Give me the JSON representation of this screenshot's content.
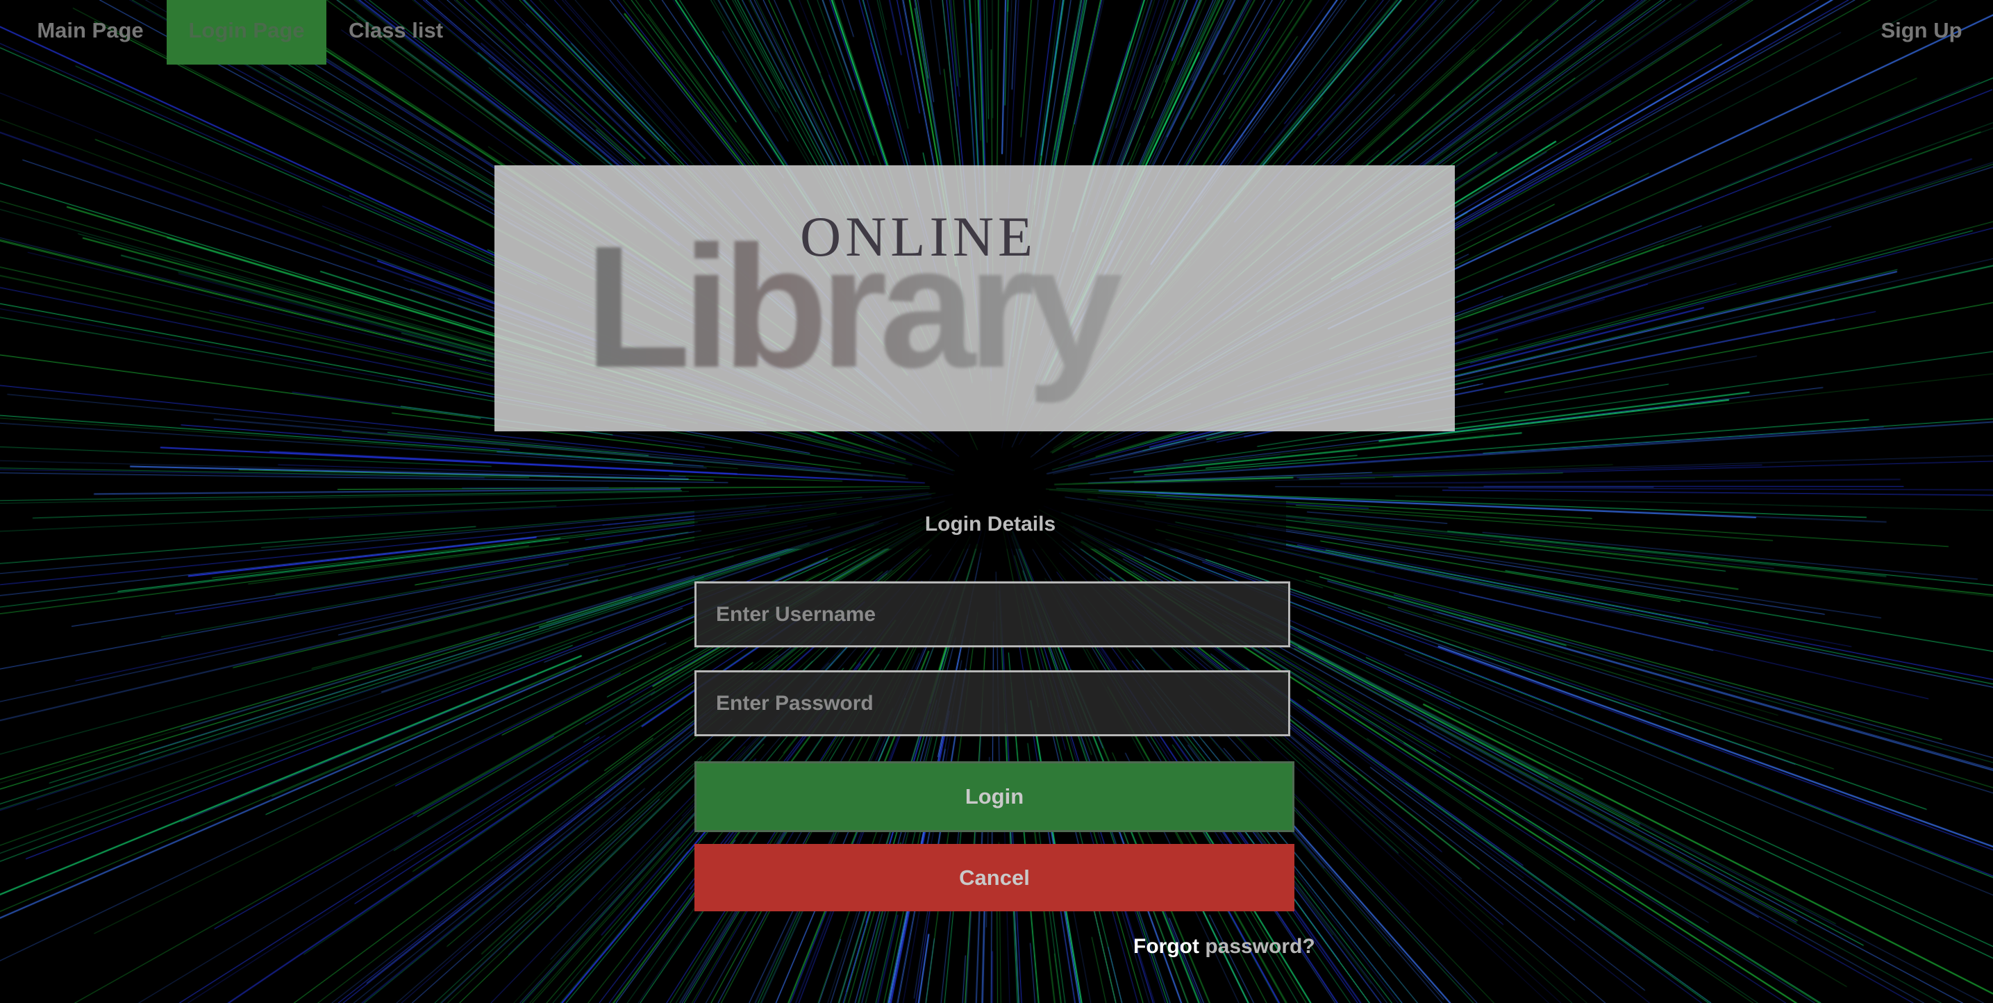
{
  "nav": {
    "items": [
      {
        "label": "Main Page"
      },
      {
        "label": "Login Page",
        "active": true
      },
      {
        "label": "Class list"
      }
    ],
    "signup_label": "Sign Up",
    "active_color": "#2f7a33"
  },
  "logo": {
    "top_text": "ONLINE",
    "main_text": "Library"
  },
  "form": {
    "title": "Login Details",
    "username_placeholder": "Enter Username",
    "password_placeholder": "Enter Password",
    "login_label": "Login",
    "cancel_label": "Cancel",
    "forgot_prefix": "Forgot",
    "forgot_link": "password?"
  },
  "colors": {
    "login_button": "#2f7a37",
    "cancel_button": "#b5322c",
    "background": "#000000"
  }
}
